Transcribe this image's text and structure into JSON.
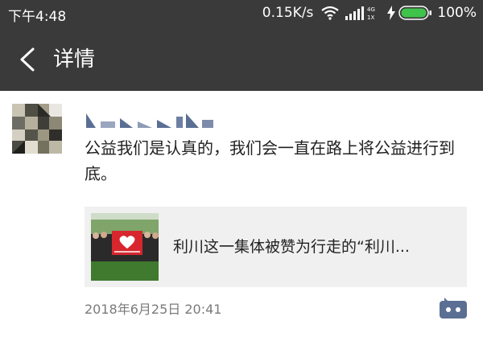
{
  "status_bar": {
    "time": "下午4:48",
    "net_speed": "0.15K/s",
    "signal_small_top": "4G",
    "signal_small_bottom": "1X",
    "battery": "100%",
    "battery_color": "#3fc34b"
  },
  "nav": {
    "back_icon": "chevron-left-icon",
    "title": "详情"
  },
  "post": {
    "text": "公益我们是认真的，我们会一直在路上将公益进行到底。",
    "link_card": {
      "title": "利川这一集体被赞为行走的“利川..."
    },
    "timestamp": "2018年6月25日 20:41",
    "comment_icon": "comment-dots-icon"
  },
  "colors": {
    "header_bg": "#3a3a3a",
    "card_bg": "#f0f0f0",
    "icon_blue": "#5b6f94"
  }
}
